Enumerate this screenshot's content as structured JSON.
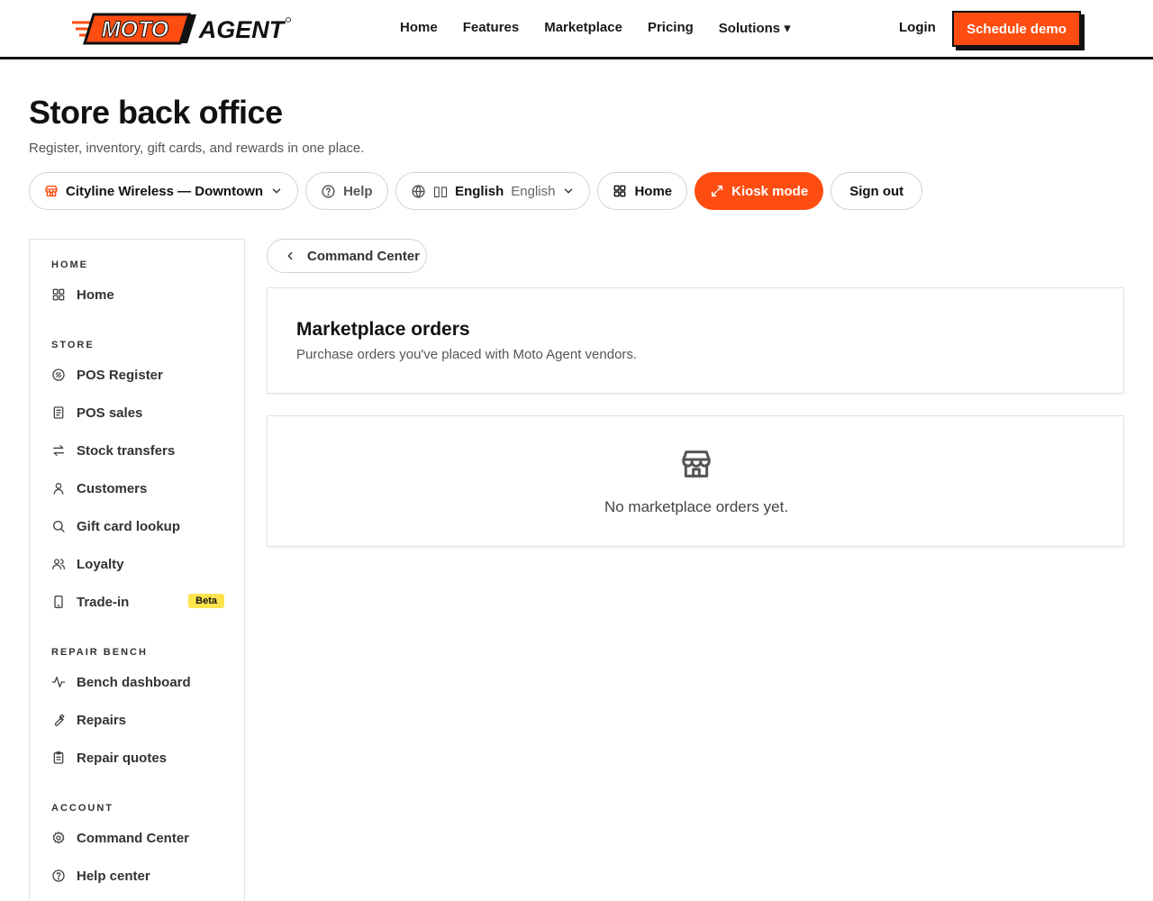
{
  "brand": {
    "moto": "MOTO",
    "agent": "AGENT",
    "accent": "#ff4d12"
  },
  "nav": {
    "links": [
      "Home",
      "Features",
      "Marketplace",
      "Pricing",
      "Solutions ▾"
    ],
    "login": "Login",
    "schedule": "Schedule demo"
  },
  "header": {
    "title": "Store back office",
    "subtitle": "Register, inventory, gift cards, and rewards in one place."
  },
  "toolbar": {
    "store": "Cityline Wireless — Downtown",
    "help": "Help",
    "lang_flag": "▯▯",
    "lang_primary": "English",
    "lang_secondary": "English",
    "home": "Home",
    "kiosk": "Kiosk mode",
    "signout": "Sign out"
  },
  "sidebar": {
    "sections": [
      {
        "label": "HOME",
        "items": [
          {
            "label": "Home",
            "icon": "grid-icon"
          }
        ]
      },
      {
        "label": "STORE",
        "items": [
          {
            "label": "POS Register",
            "icon": "register-icon"
          },
          {
            "label": "POS sales",
            "icon": "receipt-icon"
          },
          {
            "label": "Stock transfers",
            "icon": "transfer-icon"
          },
          {
            "label": "Customers",
            "icon": "user-icon"
          },
          {
            "label": "Gift card lookup",
            "icon": "search-icon"
          },
          {
            "label": "Loyalty",
            "icon": "users-icon"
          },
          {
            "label": "Trade-in",
            "icon": "phone-icon",
            "badge": "Beta"
          }
        ]
      },
      {
        "label": "REPAIR BENCH",
        "items": [
          {
            "label": "Bench dashboard",
            "icon": "activity-icon"
          },
          {
            "label": "Repairs",
            "icon": "wrench-icon"
          },
          {
            "label": "Repair quotes",
            "icon": "clipboard-icon"
          }
        ]
      },
      {
        "label": "ACCOUNT",
        "items": [
          {
            "label": "Command Center",
            "icon": "gear-icon"
          },
          {
            "label": "Help center",
            "icon": "help-icon"
          }
        ]
      }
    ]
  },
  "main": {
    "back_label": "Command Center",
    "orders_title": "Marketplace orders",
    "orders_subtitle": "Purchase orders you've placed with Moto Agent vendors.",
    "empty_text": "No marketplace orders yet."
  }
}
